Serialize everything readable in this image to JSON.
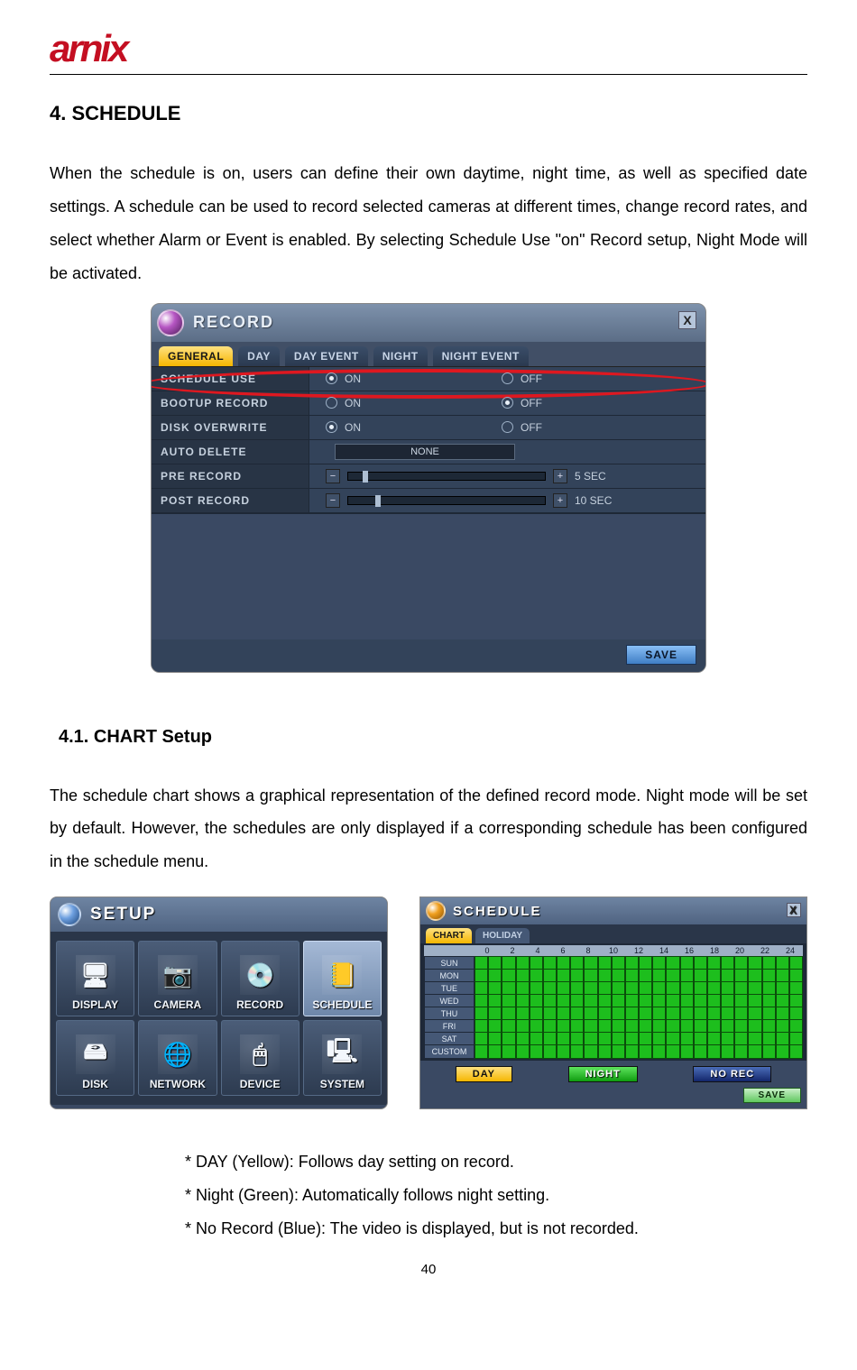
{
  "logo": "arnix",
  "heading1": "4.  SCHEDULE",
  "para1": "When  the  schedule  is  on,  users  can  define  their  own  daytime,  night  time,  as  well  as specified  date  settings.  A  schedule  can  be  used  to  record  selected  cameras  at  different times,  change  record  rates,  and  select  whether  Alarm  or  Event  is  enabled.  By  selecting Schedule Use \"on\" Record setup, Night Mode will be activated.",
  "record": {
    "title": "RECORD",
    "tabs": [
      "GENERAL",
      "DAY",
      "DAY EVENT",
      "NIGHT",
      "NIGHT EVENT"
    ],
    "rows": {
      "schedule_use": {
        "label": "SCHEDULE USE",
        "on": "ON",
        "off": "OFF",
        "selected": "ON"
      },
      "bootup_record": {
        "label": "BOOTUP RECORD",
        "on": "ON",
        "off": "OFF",
        "selected": "OFF"
      },
      "disk_overwrite": {
        "label": "DISK OVERWRITE",
        "on": "ON",
        "off": "OFF",
        "selected": "ON"
      },
      "auto_delete": {
        "label": "AUTO DELETE",
        "value": "NONE"
      },
      "pre_record": {
        "label": "PRE RECORD",
        "value": "5 SEC"
      },
      "post_record": {
        "label": "POST RECORD",
        "value": "10 SEC"
      }
    },
    "save": "SAVE"
  },
  "heading2": "4.1.  CHART  Setup",
  "para2": "The  schedule  chart  shows  a  graphical  representation  of  the  defined  record  mode.  Night mode  will  be  set  by  default.  However,  the  schedules  are  only  displayed  if  a  corresponding schedule has been configured in the schedule menu.",
  "setup": {
    "title": "SETUP",
    "items": [
      {
        "label": "DISPLAY",
        "icon": "🖥"
      },
      {
        "label": "CAMERA",
        "icon": "📷"
      },
      {
        "label": "RECORD",
        "icon": "💿"
      },
      {
        "label": "SCHEDULE",
        "icon": "📒",
        "hl": true
      },
      {
        "label": "DISK",
        "icon": "🖴"
      },
      {
        "label": "NETWORK",
        "icon": "🌐"
      },
      {
        "label": "DEVICE",
        "icon": "🖱"
      },
      {
        "label": "SYSTEM",
        "icon": "🖳"
      }
    ]
  },
  "schedule_chart": {
    "title": "SCHEDULE",
    "tabs": [
      "CHART",
      "HOLIDAY"
    ],
    "hours": [
      "0",
      "2",
      "4",
      "6",
      "8",
      "10",
      "12",
      "14",
      "16",
      "18",
      "20",
      "22",
      "24"
    ],
    "days": [
      "SUN",
      "MON",
      "TUE",
      "WED",
      "THU",
      "FRI",
      "SAT",
      "CUSTOM"
    ],
    "legend": {
      "day": "DAY",
      "night": "NIGHT",
      "norec": "NO REC"
    },
    "save": "SAVE"
  },
  "notes": {
    "n1": "* DAY (Yellow): Follows day setting on record.",
    "n2": "* Night (Green): Automatically follows night setting.",
    "n3": "* No Record (Blue): The video is displayed, but is not recorded."
  },
  "page_number": "40"
}
